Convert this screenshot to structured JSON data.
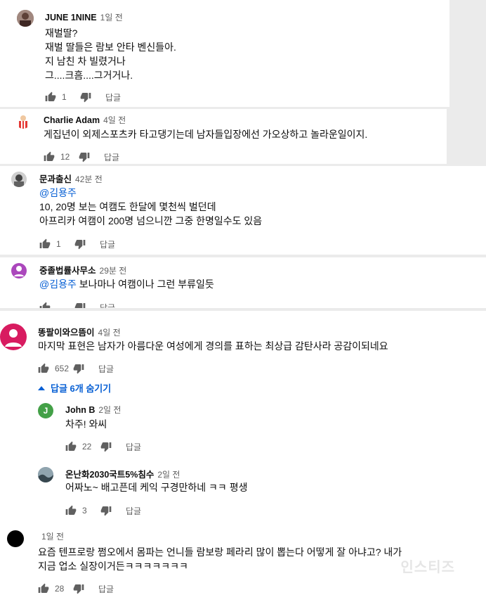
{
  "comments": [
    {
      "author": "JUNE 1NINE",
      "time": "1일 전",
      "lines": [
        "재벌딸?",
        "재벌 딸들은 람보 안타 벤신들아.",
        "지 남친 차 빌렸거나",
        "그....크흠....그거거나."
      ],
      "likes": "1",
      "reply": "답글"
    },
    {
      "author": "Charlie Adam",
      "time": "4일 전",
      "lines": [
        "게집년이 외제스포츠카 타고댕기는데 남자들입장에선 가오상하고 놀라운일이지."
      ],
      "likes": "12",
      "reply": "답글"
    },
    {
      "author": "문과출신",
      "time": "42분 전",
      "mention": "@김용주",
      "lines": [
        "10, 20명 보는 여캠도 한달에 몇천씩 벌던데",
        "아프리카 여캠이 200명 넘으니깐 그중 한명일수도 있음"
      ],
      "likes": "1",
      "reply": "답글"
    },
    {
      "author": "중졸법률사무소",
      "time": "29분 전",
      "mention": "@김용주",
      "mention_text": "보나마나 여캠이나 그런 부류일듯",
      "reply": "답글"
    },
    {
      "author": "똥팔이와으뜸이",
      "time": "4일 전",
      "lines": [
        "마지막 표현은 남자가 아름다운 여성에게 경의를 표하는 최상급 감탄사라 공감이되네요"
      ],
      "likes": "652",
      "reply": "답글",
      "replies_toggle": "답글 6개 숨기기"
    },
    {
      "author": "John B",
      "time": "2일 전",
      "initial": "J",
      "lines": [
        "차주! 와씨"
      ],
      "likes": "22",
      "reply": "답글"
    },
    {
      "author": "온난화2030국트5%침수",
      "time": "2일 전",
      "lines": [
        "어짜노~ 배고픈데 케익 구경만하네 ㅋㅋ 평생"
      ],
      "likes": "3",
      "reply": "답글"
    },
    {
      "author": "",
      "time": "1일 전",
      "lines": [
        "요즘 텐프로랑 쩜오에서 몸파는 언니들 람보랑 페라리 많이 뽑는다 어떻게 잘 아냐고? 내가",
        "지금 업소 실장이거든ㅋㅋㅋㅋㅋㅋㅋ"
      ],
      "likes": "28",
      "reply": "답글"
    }
  ],
  "watermark": "인스티즈",
  "colors": {
    "link": "#065fd4",
    "meta": "#606060",
    "text": "#0f0f0f",
    "john_avatar": "#43a047",
    "pink_avatar": "#d81b60",
    "purple_avatar": "#ab47bc"
  }
}
